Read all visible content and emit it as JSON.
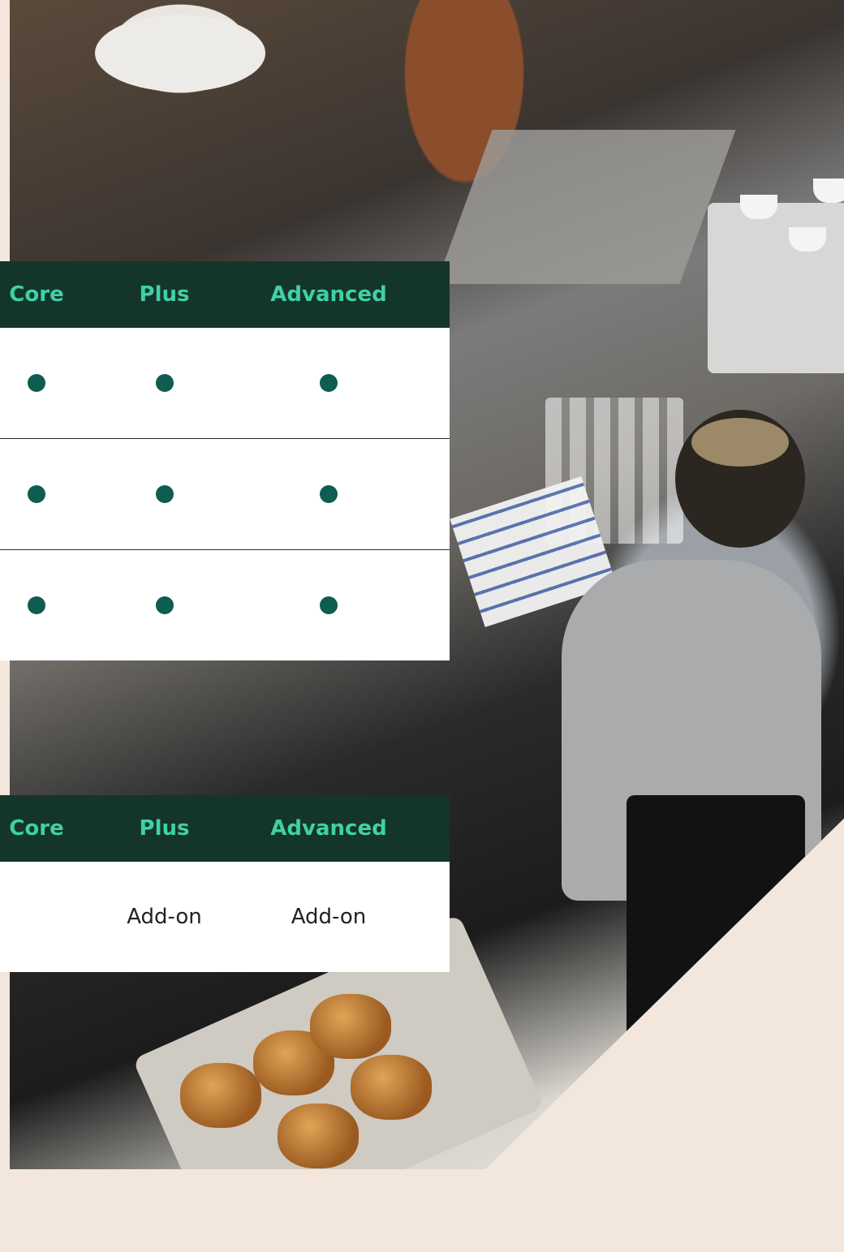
{
  "colors": {
    "header_bg": "#14352a",
    "header_text": "#3fd1a5",
    "dot": "#0f5c52",
    "page_bg": "#f3e6dc"
  },
  "table1": {
    "headers": [
      "Core",
      "Plus",
      "Advanced"
    ],
    "rows": [
      [
        "dot",
        "dot",
        "dot"
      ],
      [
        "dot",
        "dot",
        "dot"
      ],
      [
        "dot",
        "dot",
        "dot"
      ]
    ]
  },
  "table2": {
    "headers": [
      "Core",
      "Plus",
      "Advanced"
    ],
    "rows": [
      [
        "",
        "Add-on",
        "Add-on"
      ]
    ]
  }
}
